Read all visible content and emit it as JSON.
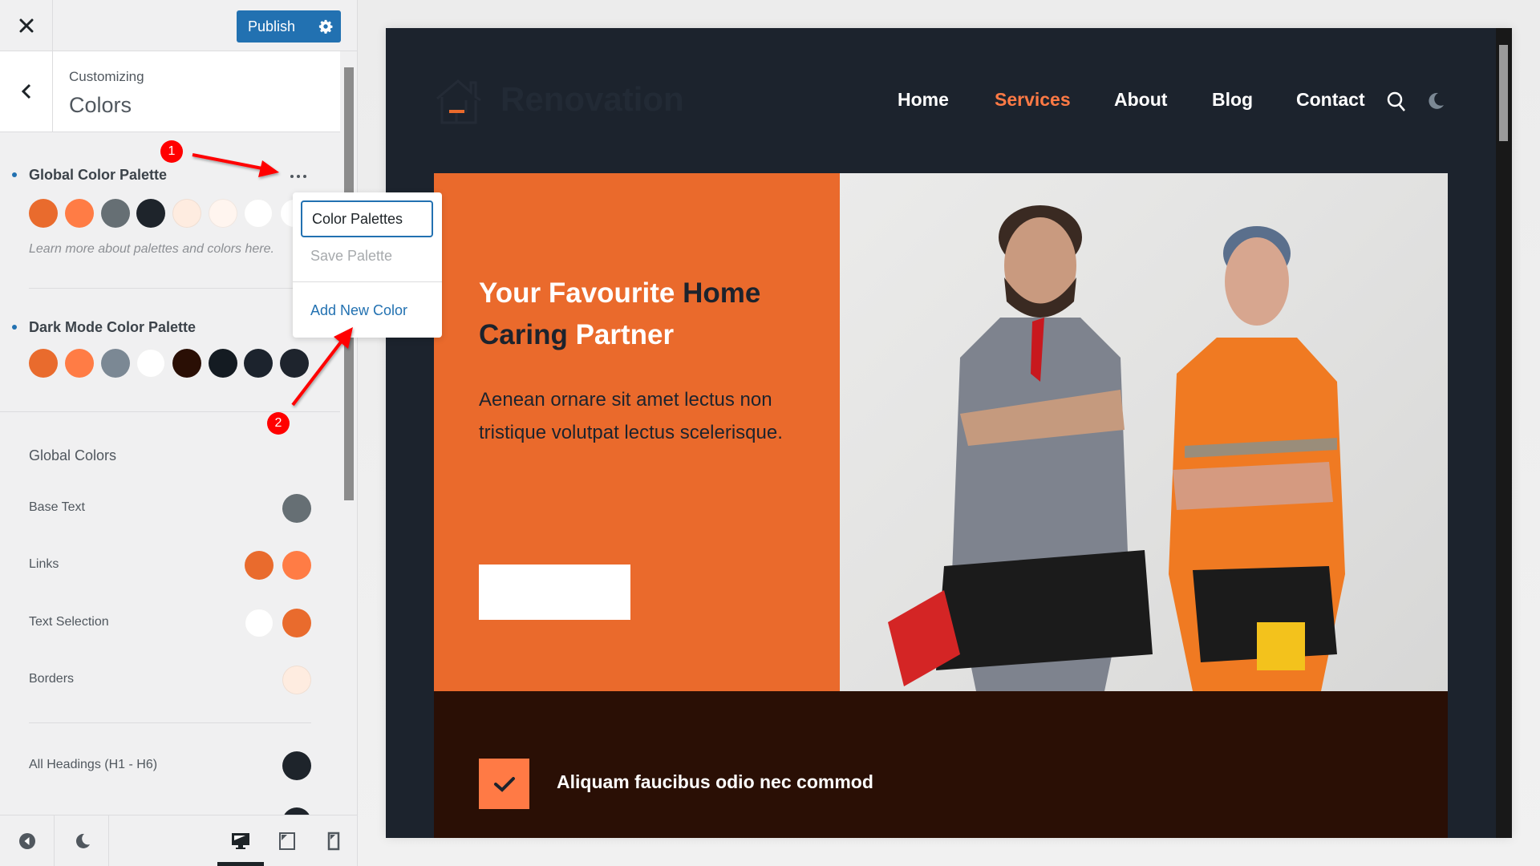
{
  "topbar": {
    "close_label": "Close",
    "publish_label": "Publish"
  },
  "header": {
    "subtitle": "Customizing",
    "title": "Colors"
  },
  "global_palette": {
    "title": "Global Color Palette",
    "colors": [
      "#e96b2d",
      "#ff7c45",
      "#666f74",
      "#1e242b",
      "#feece0",
      "#fff5ef",
      "#ffffff",
      "#ffffff"
    ],
    "help_text": "Learn more about palettes and colors here."
  },
  "palette_menu": {
    "items": [
      {
        "label": "Color Palettes",
        "state": "focused"
      },
      {
        "label": "Save Palette",
        "state": "disabled"
      },
      {
        "label": "Add New Color",
        "state": "link"
      }
    ]
  },
  "dark_palette": {
    "title": "Dark Mode Color Palette",
    "colors": [
      "#e96b2d",
      "#ff7c45",
      "#7b8894",
      "#ffffff",
      "#2a0f05",
      "#141b22",
      "#1c232d",
      "#1e242d"
    ]
  },
  "global_colors": {
    "title": "Global Colors",
    "rows": [
      {
        "label": "Base Text",
        "colors": [
          "#666f74"
        ]
      },
      {
        "label": "Links",
        "colors": [
          "#e96b2d",
          "#ff7c45"
        ]
      },
      {
        "label": "Text Selection",
        "colors": [
          "#ffffff",
          "#e96b2d"
        ]
      },
      {
        "label": "Borders",
        "colors": [
          "#feece0"
        ]
      },
      {
        "label": "All Headings (H1 - H6)",
        "colors": [
          "#1e242b"
        ]
      }
    ]
  },
  "annotations": {
    "badge1": "1",
    "badge2": "2"
  },
  "bottombar": {
    "active_device": "desktop"
  },
  "site": {
    "logo_text": "Renovation",
    "nav": [
      {
        "label": "Home",
        "active": false
      },
      {
        "label": "Services",
        "active": true
      },
      {
        "label": "About",
        "active": false
      },
      {
        "label": "Blog",
        "active": false
      },
      {
        "label": "Contact",
        "active": false
      }
    ],
    "hero": {
      "title_part1": "Your Favourite ",
      "title_part2": "Home Caring",
      "title_part3": " Partner",
      "text": "Aenean ornare sit amet lectus non tristique volutpat lectus scelerisque.",
      "button_label": ""
    },
    "band_text": "Aliquam faucibus odio nec commod"
  },
  "colors": {
    "accent": "#2271b1",
    "brand_orange": "#ea6a2c",
    "brand_orange_light": "#ff7a45",
    "site_bg": "#1c232d",
    "band_bg": "#2a0f05"
  }
}
